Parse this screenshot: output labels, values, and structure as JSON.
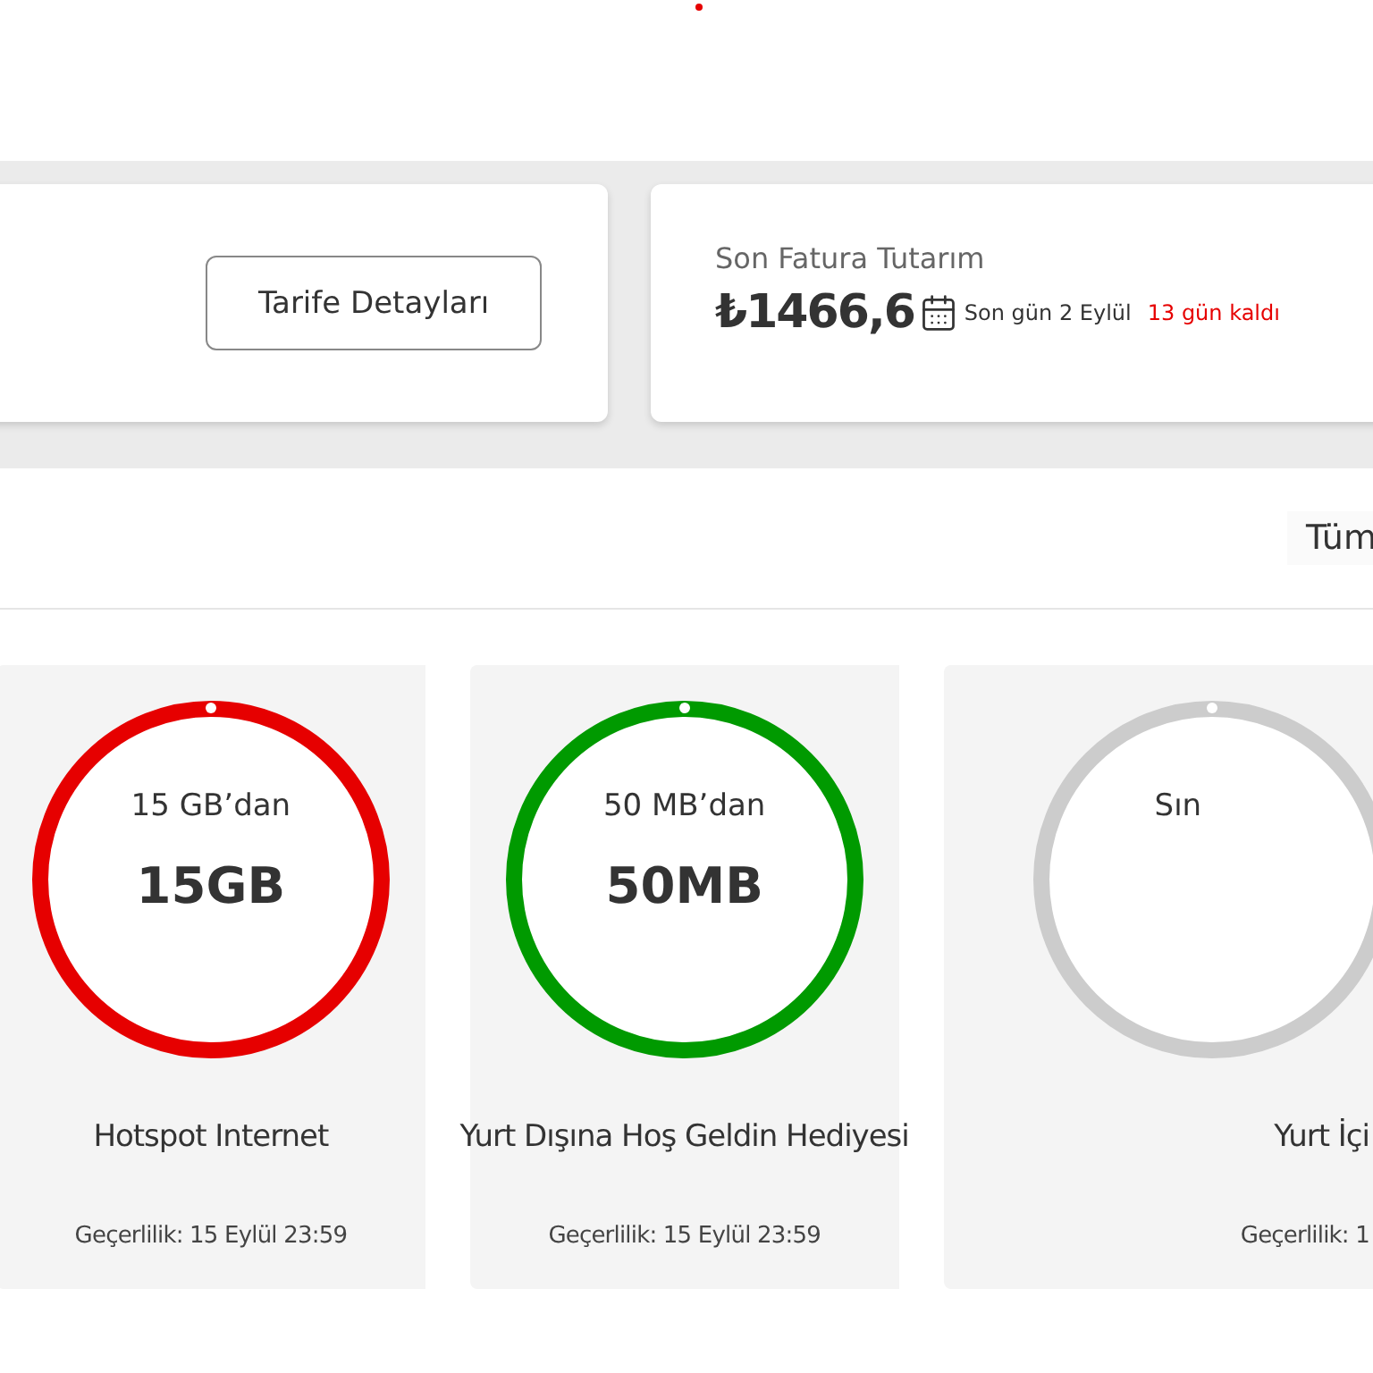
{
  "tariff_card": {
    "button": "Tarife Detayları"
  },
  "bill_card": {
    "title": "Son Fatura Tutarım",
    "amount": "₺1466,6",
    "due": "Son gün 2 Eylül",
    "remaining": "13 gün kaldı"
  },
  "section_header": {
    "link": "Tüm"
  },
  "packages": [
    {
      "caption": "15 GB’dan",
      "value": "15GB",
      "name": "Hotspot Internet",
      "validity": "Geçerlilik: 15 Eylül 23:59",
      "color": "#e60000"
    },
    {
      "caption": "50 MB’dan",
      "value": "50MB",
      "name": "Yurt Dışına Hoş Geldin Hediyesi",
      "validity": "Geçerlilik: 15 Eylül 23:59",
      "color": "#009a00"
    },
    {
      "caption": "Sın",
      "name": "Yurt İçi",
      "validity": "Geçerlilik: 1",
      "color": "#cccccc"
    }
  ]
}
